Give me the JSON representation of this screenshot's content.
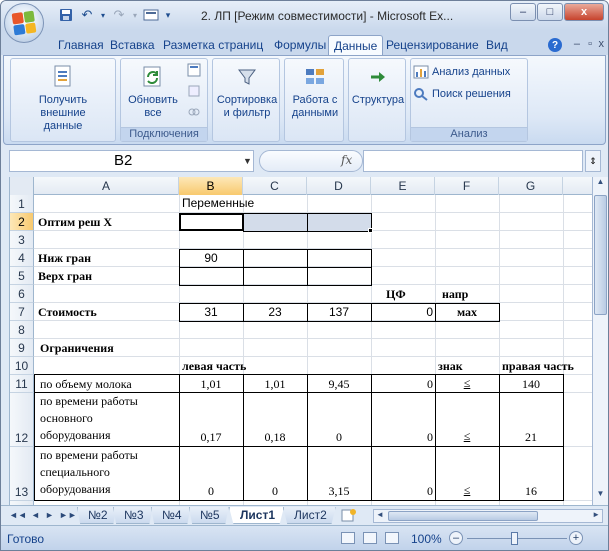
{
  "window": {
    "title": "2. ЛП  [Режим совместимости] - Microsoft Ex...",
    "buttons": {
      "minimize": "–",
      "maximize": "□",
      "close": "x"
    }
  },
  "qat": {
    "icons": [
      "save-icon",
      "undo-icon",
      "redo-icon",
      "custom-icon"
    ]
  },
  "ribbon": {
    "tabs": [
      "Главная",
      "Вставка",
      "Разметка страниц",
      "Формулы",
      "Данные",
      "Рецензирование",
      "Вид"
    ],
    "active_tab": "Данные",
    "groups": {
      "external": {
        "button": "Получить внешние данные"
      },
      "connections": {
        "refresh": "Обновить все",
        "label": "Подключения"
      },
      "sort": {
        "button": "Сортировка и фильтр"
      },
      "tools": {
        "button": "Работа с данными"
      },
      "outline": {
        "button": "Структура"
      },
      "analysis": {
        "data_analysis": "Анализ данных",
        "solver": "Поиск решения",
        "label": "Анализ"
      }
    }
  },
  "formula_bar": {
    "name_box": "B2",
    "fx": "fx",
    "formula": ""
  },
  "grid": {
    "columns": [
      "A",
      "B",
      "C",
      "D",
      "E",
      "F",
      "G"
    ],
    "selected_column": "B",
    "rows": [
      "1",
      "2",
      "3",
      "4",
      "5",
      "6",
      "7",
      "8",
      "9",
      "10",
      "11",
      "12",
      "13"
    ],
    "selected_row": "2"
  },
  "cells": {
    "B1": "Переменные",
    "A2": "Оптим реш Х",
    "A4": "Ниж гран",
    "B4": "90",
    "A5": "Верх гран",
    "E6": "ЦФ",
    "F6": "напр",
    "A7": "Стоимость",
    "B7": "31",
    "C7": "23",
    "D7": "137",
    "E7": "0",
    "F7": "мах",
    "A9": "Ограничения",
    "B10": "левая часть",
    "F10": "знак",
    "G10": "правая часть",
    "A11": "по объему молока",
    "B11": "1,01",
    "C11": "1,01",
    "D11": "9,45",
    "E11": "0",
    "F11": "≤",
    "G11": "140",
    "A12_1": "по времени работы",
    "A12_2": "основного",
    "A12_3": "оборудования",
    "B12": "0,17",
    "C12": "0,18",
    "D12": "0",
    "E12": "0",
    "F12": "≤",
    "G12": "21",
    "A13_1": "по времени работы",
    "A13_2": "специального",
    "A13_3": "оборудования",
    "B13": "0",
    "C13": "0",
    "D13": "3,15",
    "E13": "0",
    "F13": "≤",
    "G13": "16"
  },
  "sheets": {
    "tabs": [
      "№2",
      "№3",
      "№4",
      "№5",
      "Лист1",
      "Лист2"
    ],
    "active": "Лист1"
  },
  "status": {
    "text": "Готово",
    "zoom": "100%"
  }
}
